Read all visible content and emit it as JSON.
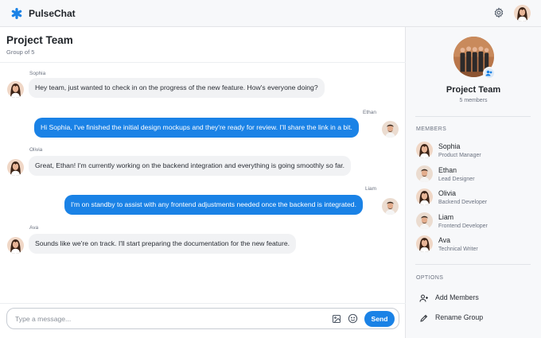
{
  "app": {
    "name": "PulseChat"
  },
  "colors": {
    "accent": "#1a82e6",
    "incoming_bubble": "#f1f2f4",
    "panel_bg": "#f7f8fa"
  },
  "icons": {
    "logo": "asterisk-logo-icon",
    "settings": "gear-icon",
    "image": "image-icon",
    "emoji": "emoji-icon",
    "add_members": "user-plus-icon",
    "rename": "pencil-icon"
  },
  "chat": {
    "title": "Project Team",
    "subtitle": "Group of 5",
    "messages": [
      {
        "sender": "Sophia",
        "text": "Hey team, just wanted to check in on the progress of the new feature. How's everyone doing?",
        "direction": "incoming"
      },
      {
        "sender": "Ethan",
        "text": "Hi Sophia, I've finished the initial design mockups and they're ready for review. I'll share the link in a bit.",
        "direction": "outgoing"
      },
      {
        "sender": "Olivia",
        "text": "Great, Ethan! I'm currently working on the backend integration and everything is going smoothly so far.",
        "direction": "incoming"
      },
      {
        "sender": "Liam",
        "text": "I'm on standby to assist with any frontend adjustments needed once the backend is integrated.",
        "direction": "outgoing"
      },
      {
        "sender": "Ava",
        "text": "Sounds like we're on track. I'll start preparing the documentation for the new feature.",
        "direction": "incoming"
      }
    ]
  },
  "composer": {
    "placeholder": "Type a message...",
    "value": "",
    "send_label": "Send"
  },
  "panel": {
    "title": "Project Team",
    "subtitle": "5 members",
    "members_label": "MEMBERS",
    "members": [
      {
        "name": "Sophia",
        "role": "Product Manager"
      },
      {
        "name": "Ethan",
        "role": "Lead Designer"
      },
      {
        "name": "Olivia",
        "role": "Backend Developer"
      },
      {
        "name": "Liam",
        "role": "Frontend Developer"
      },
      {
        "name": "Ava",
        "role": "Technical Writer"
      }
    ],
    "options_label": "OPTIONS",
    "options": [
      {
        "label": "Add Members"
      },
      {
        "label": "Rename Group"
      }
    ]
  }
}
